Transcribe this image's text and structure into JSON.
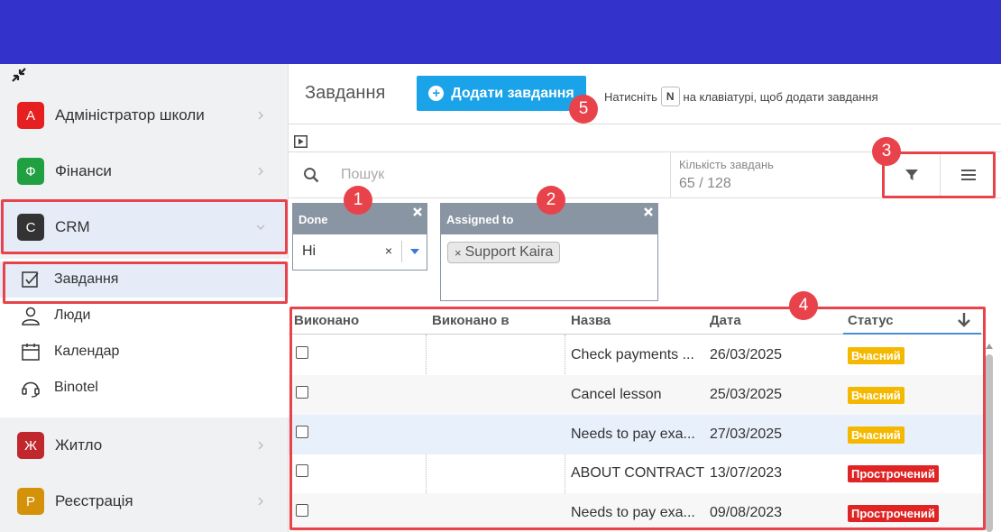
{
  "colors": {
    "topbar": "#3333cc",
    "accent": "#1aa3e8",
    "annotation": "#e8434b",
    "status_ontime": "#f5b800",
    "status_overdue": "#e02424"
  },
  "sidebar": {
    "collapse_icon": "collapse-arrows-icon",
    "modules": [
      {
        "letter": "A",
        "label": "Адміністратор школи",
        "color": "#e62020"
      },
      {
        "letter": "Ф",
        "label": "Фінанси",
        "color": "#20a040"
      },
      {
        "letter": "C",
        "label": "CRM",
        "color": "#333333"
      },
      {
        "letter": "Ж",
        "label": "Житло",
        "color": "#c0282d"
      },
      {
        "letter": "Р",
        "label": "Реєстрація",
        "color": "#d4920a"
      }
    ],
    "crm_items": [
      {
        "label": "Завдання",
        "icon": "checkbox-icon"
      },
      {
        "label": "Люди",
        "icon": "person-icon"
      },
      {
        "label": "Календар",
        "icon": "calendar-icon"
      },
      {
        "label": "Binotel",
        "icon": "headset-icon"
      }
    ]
  },
  "header": {
    "title": "Завдання",
    "add_button": "Додати завдання",
    "hint_before": "Натисніть",
    "hint_key": "N",
    "hint_after": "на клавіатурі, щоб додати завдання"
  },
  "toolbar": {
    "search_placeholder": "Пошук",
    "count_label": "Кількість завдань",
    "count_value": "65 / 128"
  },
  "filters": {
    "done": {
      "title": "Done",
      "value": "Ні"
    },
    "assigned": {
      "title": "Assigned to",
      "tag": "Support Kaira"
    }
  },
  "table": {
    "columns": [
      "Виконано",
      "Виконано в",
      "Назва",
      "Дата",
      "Статус"
    ],
    "rows": [
      {
        "name": "Check payments ...",
        "date": "26/03/2025",
        "status": "Вчасний"
      },
      {
        "name": "Cancel lesson",
        "date": "25/03/2025",
        "status": "Вчасний"
      },
      {
        "name": "Needs to pay exa...",
        "date": "27/03/2025",
        "status": "Вчасний"
      },
      {
        "name": "ABOUT CONTRACT",
        "date": "13/07/2023",
        "status": "Прострочений"
      },
      {
        "name": "Needs to pay exa...",
        "date": "09/08/2023",
        "status": "Прострочений"
      }
    ]
  },
  "annotations": [
    "1",
    "2",
    "3",
    "4",
    "5"
  ]
}
